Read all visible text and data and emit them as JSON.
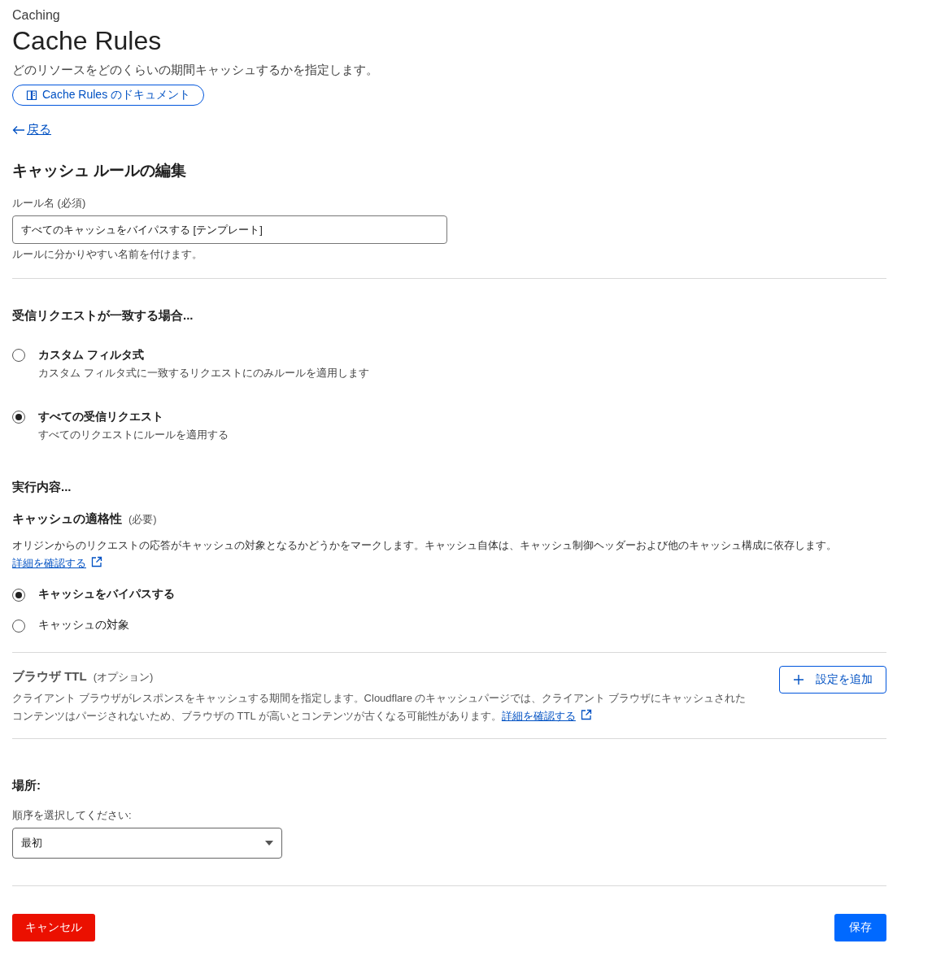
{
  "breadcrumb": "Caching",
  "title": "Cache Rules",
  "subtitle": "どのリソースをどのくらいの期間キャッシュするかを指定します。",
  "docs_button": "Cache Rules のドキュメント",
  "back_link": "戻る",
  "section_title": "キャッシュ ルールの編集",
  "rule_name": {
    "label": "ルール名 (必須)",
    "value": "すべてのキャッシュをバイパスする [テンプレート]",
    "help": "ルールに分かりやすい名前を付けます。"
  },
  "match": {
    "title": "受信リクエストが一致する場合...",
    "options": [
      {
        "label": "カスタム フィルタ式",
        "description": "カスタム フィルタ式に一致するリクエストにのみルールを適用します",
        "selected": false
      },
      {
        "label": "すべての受信リクエスト",
        "description": "すべてのリクエストにルールを適用する",
        "selected": true
      }
    ]
  },
  "then": {
    "title": "実行内容...",
    "eligibility": {
      "label": "キャッシュの適格性",
      "tag": "(必要)",
      "description": "オリジンからのリクエストの応答がキャッシュの対象となるかどうかをマークします。キャッシュ自体は、キャッシュ制御ヘッダーおよび他のキャッシュ構成に依存します。",
      "link": "詳細を確認する",
      "options": [
        {
          "label": "キャッシュをバイパスする",
          "selected": true
        },
        {
          "label": "キャッシュの対象",
          "selected": false
        }
      ]
    },
    "browser_ttl": {
      "label": "ブラウザ TTL",
      "tag": "(オプション)",
      "description": "クライアント ブラウザがレスポンスをキャッシュする期間を指定します。Cloudflare のキャッシュパージでは、クライアント ブラウザにキャッシュされたコンテンツはパージされないため、ブラウザの TTL が高いとコンテンツが古くなる可能性があります。",
      "link": "詳細を確認する",
      "button": "設定を追加"
    }
  },
  "place": {
    "title": "場所:",
    "label": "順序を選択してください:",
    "value": "最初"
  },
  "buttons": {
    "cancel": "キャンセル",
    "save": "保存"
  }
}
